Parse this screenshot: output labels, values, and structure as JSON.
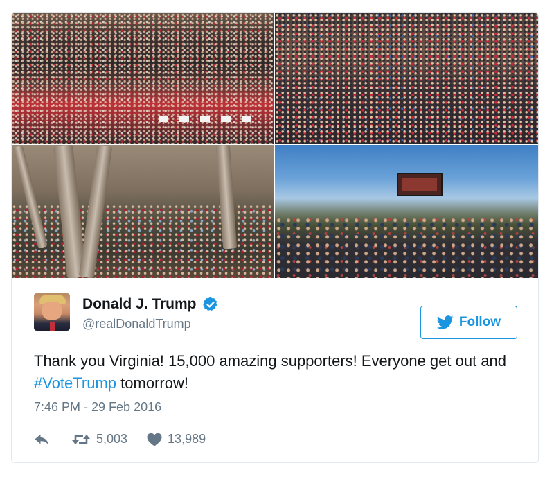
{
  "media": {
    "photos": [
      {
        "alt": ""
      },
      {
        "alt": ""
      },
      {
        "alt": ""
      },
      {
        "alt": ""
      }
    ]
  },
  "author": {
    "display_name": "Donald J. Trump",
    "handle": "@realDonaldTrump",
    "verified_icon": "verified-badge-icon"
  },
  "follow_button": {
    "label": "Follow",
    "icon": "twitter-bird-icon"
  },
  "tweet": {
    "text_before": "Thank you Virginia! 15,000 amazing supporters! Everyone get out and ",
    "hashtag": "#VoteTrump",
    "text_after": " tomorrow!",
    "timestamp": "7:46 PM - 29 Feb 2016"
  },
  "actions": {
    "retweet_count": "5,003",
    "like_count": "13,989"
  },
  "colors": {
    "accent": "#1b95e0",
    "muted": "#657786",
    "text": "#14171a",
    "border": "#e1e8ed"
  }
}
